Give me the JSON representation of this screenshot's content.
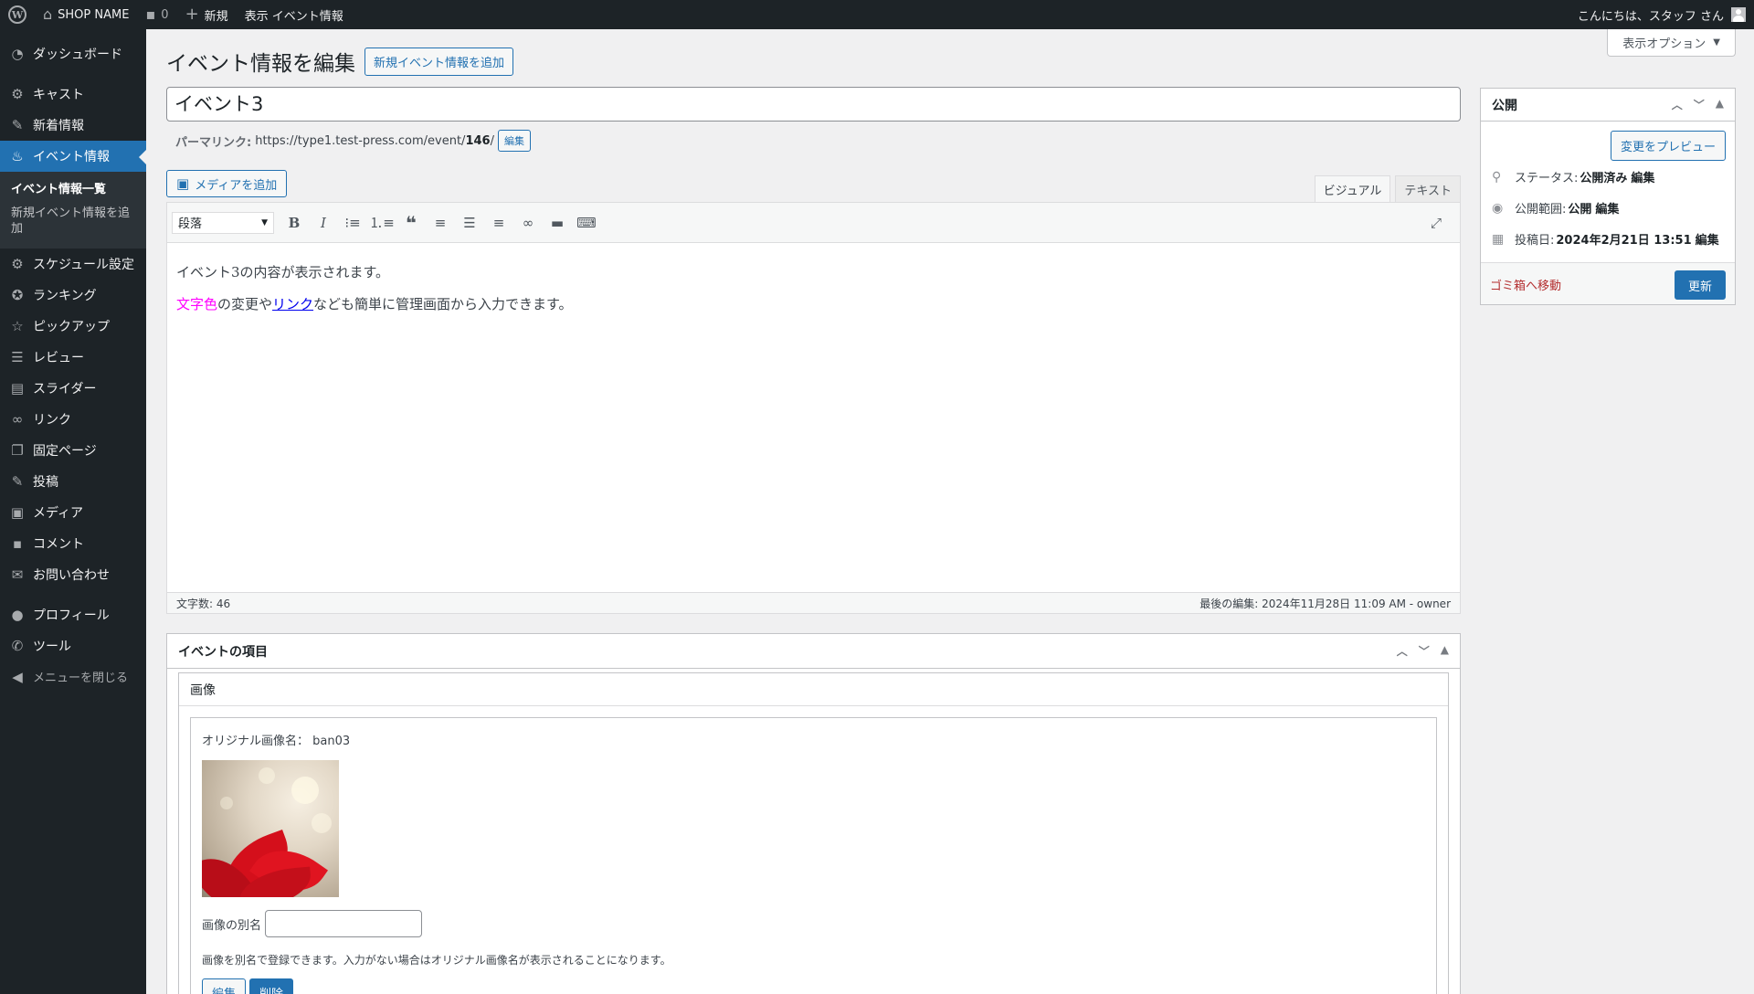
{
  "adminbar": {
    "site_name": "SHOP NAME",
    "comments_count": "0",
    "new_label": "新規",
    "view_label": "表示 イベント情報",
    "greeting": "こんにちは、スタッフ さん"
  },
  "sidebar": {
    "items": [
      {
        "label": "ダッシュボード"
      },
      {
        "label": "キャスト"
      },
      {
        "label": "新着情報"
      },
      {
        "label": "イベント情報"
      },
      {
        "label": "スケジュール設定"
      },
      {
        "label": "ランキング"
      },
      {
        "label": "ピックアップ"
      },
      {
        "label": "レビュー"
      },
      {
        "label": "スライダー"
      },
      {
        "label": "リンク"
      },
      {
        "label": "固定ページ"
      },
      {
        "label": "投稿"
      },
      {
        "label": "メディア"
      },
      {
        "label": "コメント"
      },
      {
        "label": "お問い合わせ"
      },
      {
        "label": "プロフィール"
      },
      {
        "label": "ツール"
      }
    ],
    "submenu": [
      {
        "label": "イベント情報一覧"
      },
      {
        "label": "新規イベント情報を追加"
      }
    ],
    "collapse_label": "メニューを閉じる"
  },
  "screen_options": "表示オプション",
  "page": {
    "title": "イベント情報を編集",
    "add_new": "新規イベント情報を追加"
  },
  "post": {
    "title": "イベント3",
    "permalink_label": "パーマリンク:",
    "permalink_base": "https://type1.test-press.com/event/",
    "permalink_slug": "146",
    "permalink_trail": "/",
    "permalink_edit": "編集"
  },
  "editor": {
    "add_media": "メディアを追加",
    "tab_visual": "ビジュアル",
    "tab_text": "テキスト",
    "format_select": "段落",
    "line1": "イベント3の内容が表示されます。",
    "line2_colored": "文字色",
    "line2_a": "の変更や",
    "line2_link": "リンク",
    "line2_b": "なども簡単に管理画面から入力できます。",
    "word_count": "文字数: 46",
    "last_edit": "最後の編集: 2024年11月28日 11:09 AM - owner"
  },
  "publish": {
    "title": "公開",
    "preview": "変更をプレビュー",
    "status_label": "ステータス:",
    "status_value": "公開済み",
    "visibility_label": "公開範囲:",
    "visibility_value": "公開",
    "date_label": "投稿日:",
    "date_value": "2024年2月21日 13:51",
    "edit": "編集",
    "trash": "ゴミ箱へ移動",
    "update": "更新"
  },
  "event_fields": {
    "title": "イベントの項目",
    "image_label": "画像",
    "orig_label": "オリジナル画像名：",
    "orig_name": "ban03",
    "alias_label": "画像の別名",
    "help": "画像を別名で登録できます。入力がない場合はオリジナル画像名が表示されることになります。",
    "edit": "編集",
    "delete": "削除"
  },
  "colors": {
    "admin_dark": "#1d2327",
    "accent": "#2271b1",
    "danger": "#b32d2e",
    "pink_text": "#ff00ff"
  }
}
